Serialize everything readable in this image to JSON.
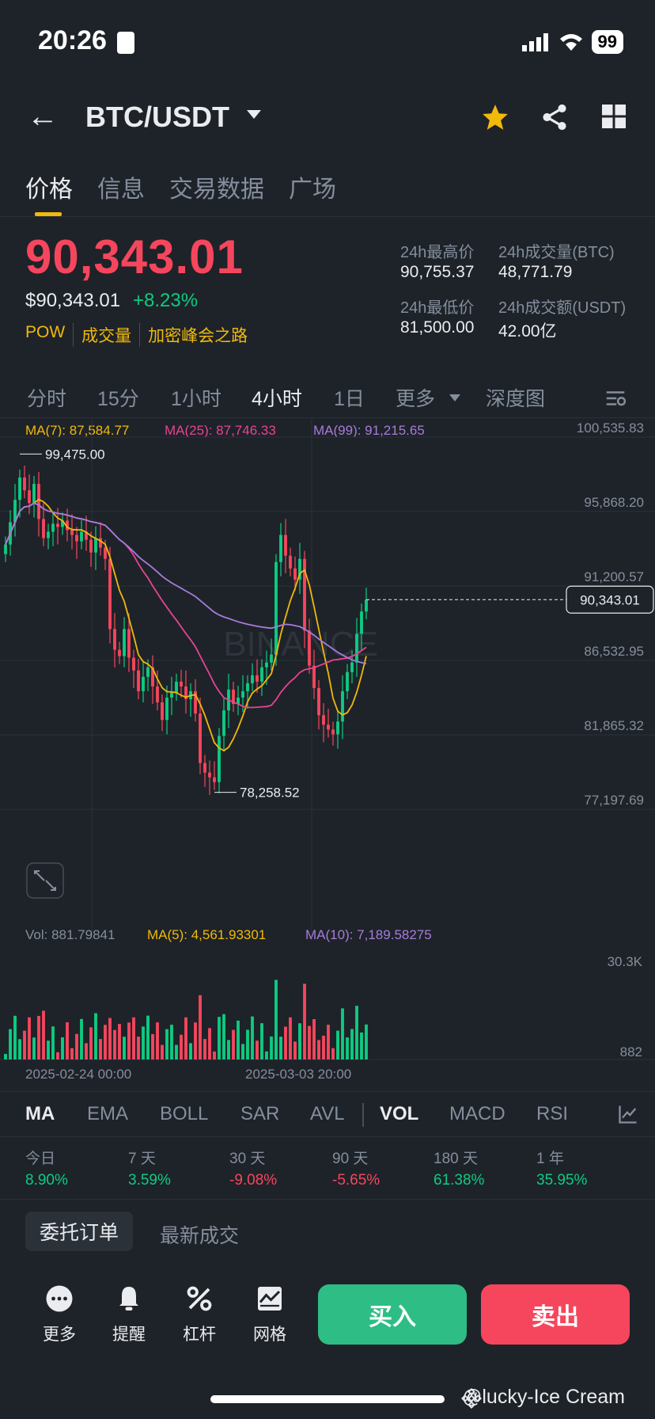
{
  "status": {
    "time": "20:26",
    "battery": "99"
  },
  "nav": {
    "pair": "BTC/USDT"
  },
  "tabs": [
    {
      "label": "价格",
      "active": true
    },
    {
      "label": "信息",
      "active": false
    },
    {
      "label": "交易数据",
      "active": false
    },
    {
      "label": "广场",
      "active": false
    }
  ],
  "ticker": {
    "last_price": "90,343.01",
    "last_price_usd": "$90,343.01",
    "change_pct": "+8.23%",
    "tags": [
      "POW",
      "成交量",
      "加密峰会之路"
    ],
    "high_label": "24h最高价",
    "high_value": "90,755.37",
    "vol_btc_label": "24h成交量(BTC)",
    "vol_btc_value": "48,771.79",
    "low_label": "24h最低价",
    "low_value": "81,500.00",
    "vol_usdt_label": "24h成交额(USDT)",
    "vol_usdt_value": "42.00亿"
  },
  "intervals": [
    {
      "label": "分时",
      "active": false
    },
    {
      "label": "15分",
      "active": false
    },
    {
      "label": "1小时",
      "active": false
    },
    {
      "label": "4小时",
      "active": true
    },
    {
      "label": "1日",
      "active": false
    },
    {
      "label": "更多",
      "active": false
    },
    {
      "label": "深度图",
      "active": false
    }
  ],
  "ma_legend": {
    "ma7": "MA(7): 87,584.77",
    "ma25": "MA(25): 87,746.33",
    "ma99": "MA(99): 91,215.65"
  },
  "vol_legend": {
    "vol": "Vol: 881.79841",
    "ma5": "MA(5): 4,561.93301",
    "ma10": "MA(10): 7,189.58275"
  },
  "chart_labels": {
    "high_marker": "99,475.00",
    "low_marker": "78,258.52",
    "current_price_tag": "90,343.01",
    "watermark": "BINANCE",
    "date_left": "2025-02-24 00:00",
    "date_right": "2025-03-03 20:00",
    "vol_top": "30.3K",
    "vol_bottom": "882"
  },
  "chart_data": {
    "type": "candlestick",
    "interval": "4h",
    "y_ticks": [
      "100,535.83",
      "95,868.20",
      "91,200.57",
      "86,532.95",
      "81,865.32",
      "77,197.69"
    ],
    "ylim": [
      77197.69,
      100535.83
    ],
    "series_close": [
      93800,
      95200,
      96600,
      98000,
      97200,
      96400,
      97600,
      95400,
      94200,
      94600,
      95100,
      94900,
      95300,
      94700,
      94400,
      94000,
      94600,
      94100,
      93300,
      94200,
      93600,
      92900,
      88500,
      87200,
      86800,
      88500,
      86700,
      85900,
      84600,
      85500,
      86100,
      84900,
      83900,
      82800,
      84200,
      84500,
      85200,
      84900,
      84100,
      84600,
      83200,
      80100,
      79500,
      79200,
      78900,
      81800,
      83400,
      84700,
      83800,
      84200,
      84600,
      85100,
      85600,
      85200,
      86100,
      86400,
      86900,
      92700,
      94400,
      93100,
      92300,
      91600,
      92900,
      88400,
      86200,
      84800,
      83100,
      82500,
      82200,
      81900,
      82700,
      84600,
      85800,
      86400,
      88200,
      89600,
      90343
    ],
    "series_bullish": [
      true,
      true,
      true,
      true,
      false,
      false,
      true,
      false,
      false,
      true,
      true,
      false,
      true,
      false,
      false,
      false,
      true,
      false,
      false,
      true,
      false,
      false,
      false,
      false,
      false,
      true,
      false,
      false,
      false,
      true,
      true,
      false,
      false,
      false,
      true,
      true,
      true,
      false,
      false,
      true,
      false,
      false,
      false,
      false,
      false,
      true,
      true,
      true,
      false,
      true,
      true,
      true,
      true,
      false,
      true,
      true,
      true,
      true,
      true,
      false,
      false,
      false,
      true,
      false,
      false,
      false,
      false,
      false,
      false,
      false,
      true,
      true,
      true,
      true,
      true,
      true,
      true
    ],
    "ma_series": [
      {
        "name": "MA(7)",
        "color": "#f0b90b",
        "last": 87584.77
      },
      {
        "name": "MA(25)",
        "color": "#e84393",
        "last": 87746.33
      },
      {
        "name": "MA(99)",
        "color": "#a77bdb",
        "last": 91215.65
      }
    ],
    "high_point": 99475.0,
    "low_point": 78258.52,
    "last_price": 90343.01
  },
  "indicators": [
    {
      "label": "MA",
      "active": true
    },
    {
      "label": "EMA",
      "active": false
    },
    {
      "label": "BOLL",
      "active": false
    },
    {
      "label": "SAR",
      "active": false
    },
    {
      "label": "AVL",
      "active": false
    },
    {
      "label": "VOL",
      "active": true
    },
    {
      "label": "MACD",
      "active": false
    },
    {
      "label": "RSI",
      "active": false
    }
  ],
  "performance": [
    {
      "label": "今日",
      "value": "8.90%",
      "positive": true
    },
    {
      "label": "7 天",
      "value": "3.59%",
      "positive": true
    },
    {
      "label": "30 天",
      "value": "-9.08%",
      "positive": false
    },
    {
      "label": "90 天",
      "value": "-5.65%",
      "positive": false
    },
    {
      "label": "180 天",
      "value": "61.38%",
      "positive": true
    },
    {
      "label": "1 年",
      "value": "35.95%",
      "positive": true
    }
  ],
  "orders": {
    "active_tab": "委托订单",
    "other_tab": "最新成交"
  },
  "bottom_bar": {
    "more": "更多",
    "alert": "提醒",
    "leverage": "杠杆",
    "grid": "网格",
    "buy": "买入",
    "sell": "卖出"
  },
  "footer_watermark": "@lucky-Ice Cream",
  "colors": {
    "up": "#0ecb81",
    "down": "#f6465d",
    "accent": "#f0b90b",
    "bg": "#1e2329"
  }
}
